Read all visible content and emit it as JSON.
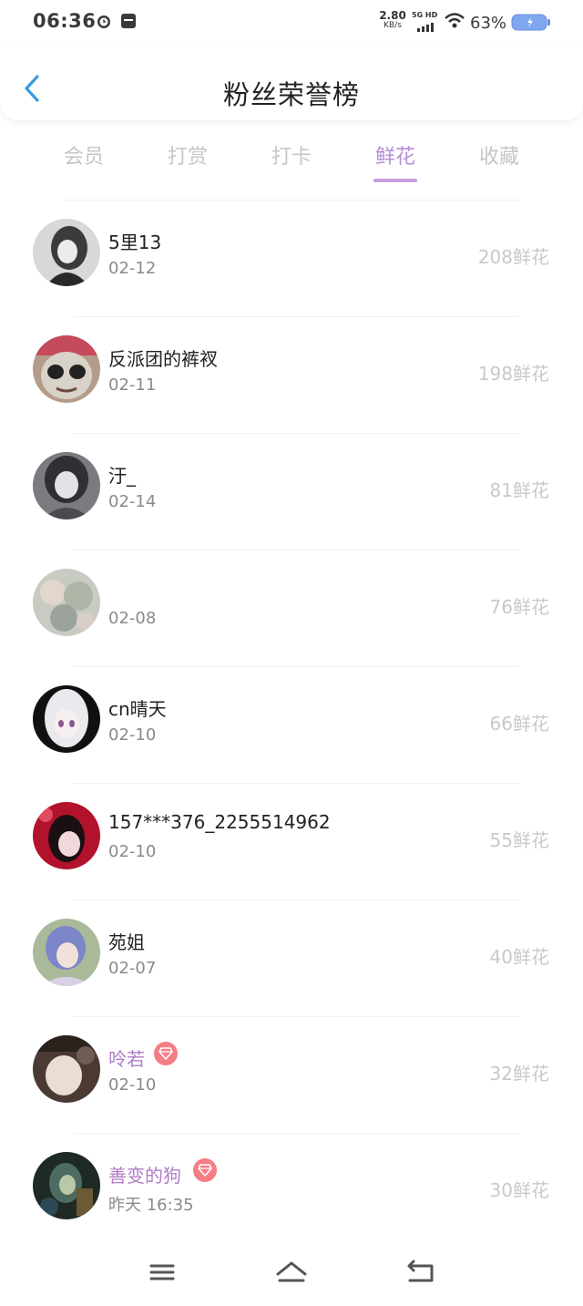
{
  "status_bar": {
    "time": "06:36",
    "net_speed_value": "2.80",
    "net_speed_unit": "KB/s",
    "network_label": "5G HD",
    "battery": "63%",
    "icons": [
      "alarm-icon",
      "app-box-icon",
      "signal-icon",
      "wifi-icon",
      "battery-icon"
    ]
  },
  "header": {
    "title": "粉丝荣誉榜",
    "back_icon": "chevron-left-icon"
  },
  "tabs": [
    {
      "label": "会员",
      "active": false
    },
    {
      "label": "打赏",
      "active": false
    },
    {
      "label": "打卡",
      "active": false
    },
    {
      "label": "鲜花",
      "active": true
    },
    {
      "label": "收藏",
      "active": false
    }
  ],
  "colors": {
    "accent": "#b58fd6",
    "vip_name": "#b07cc6",
    "vip_badge": "#f57e86",
    "back_arrow": "#3a9be0"
  },
  "fans": [
    {
      "name": "5里13",
      "date": "02-12",
      "count": "208鲜花",
      "vip": false
    },
    {
      "name": "反派团的裤衩",
      "date": "02-11",
      "count": "198鲜花",
      "vip": false
    },
    {
      "name": "汙_",
      "date": "02-14",
      "count": "81鲜花",
      "vip": false
    },
    {
      "name": "",
      "date": "02-08",
      "count": "76鲜花",
      "vip": false
    },
    {
      "name": "cn晴天",
      "date": "02-10",
      "count": "66鲜花",
      "vip": false
    },
    {
      "name": "157***376_2255514962",
      "date": "02-10",
      "count": "55鲜花",
      "vip": false
    },
    {
      "name": "苑姐",
      "date": "02-07",
      "count": "40鲜花",
      "vip": false
    },
    {
      "name": "呤若",
      "date": "02-10",
      "count": "32鲜花",
      "vip": true
    },
    {
      "name": "善变的狗",
      "date": "昨天 16:35",
      "count": "30鲜花",
      "vip": true
    }
  ],
  "nav_bar": {
    "icons": [
      "menu-icon",
      "home-icon",
      "back-icon"
    ]
  }
}
